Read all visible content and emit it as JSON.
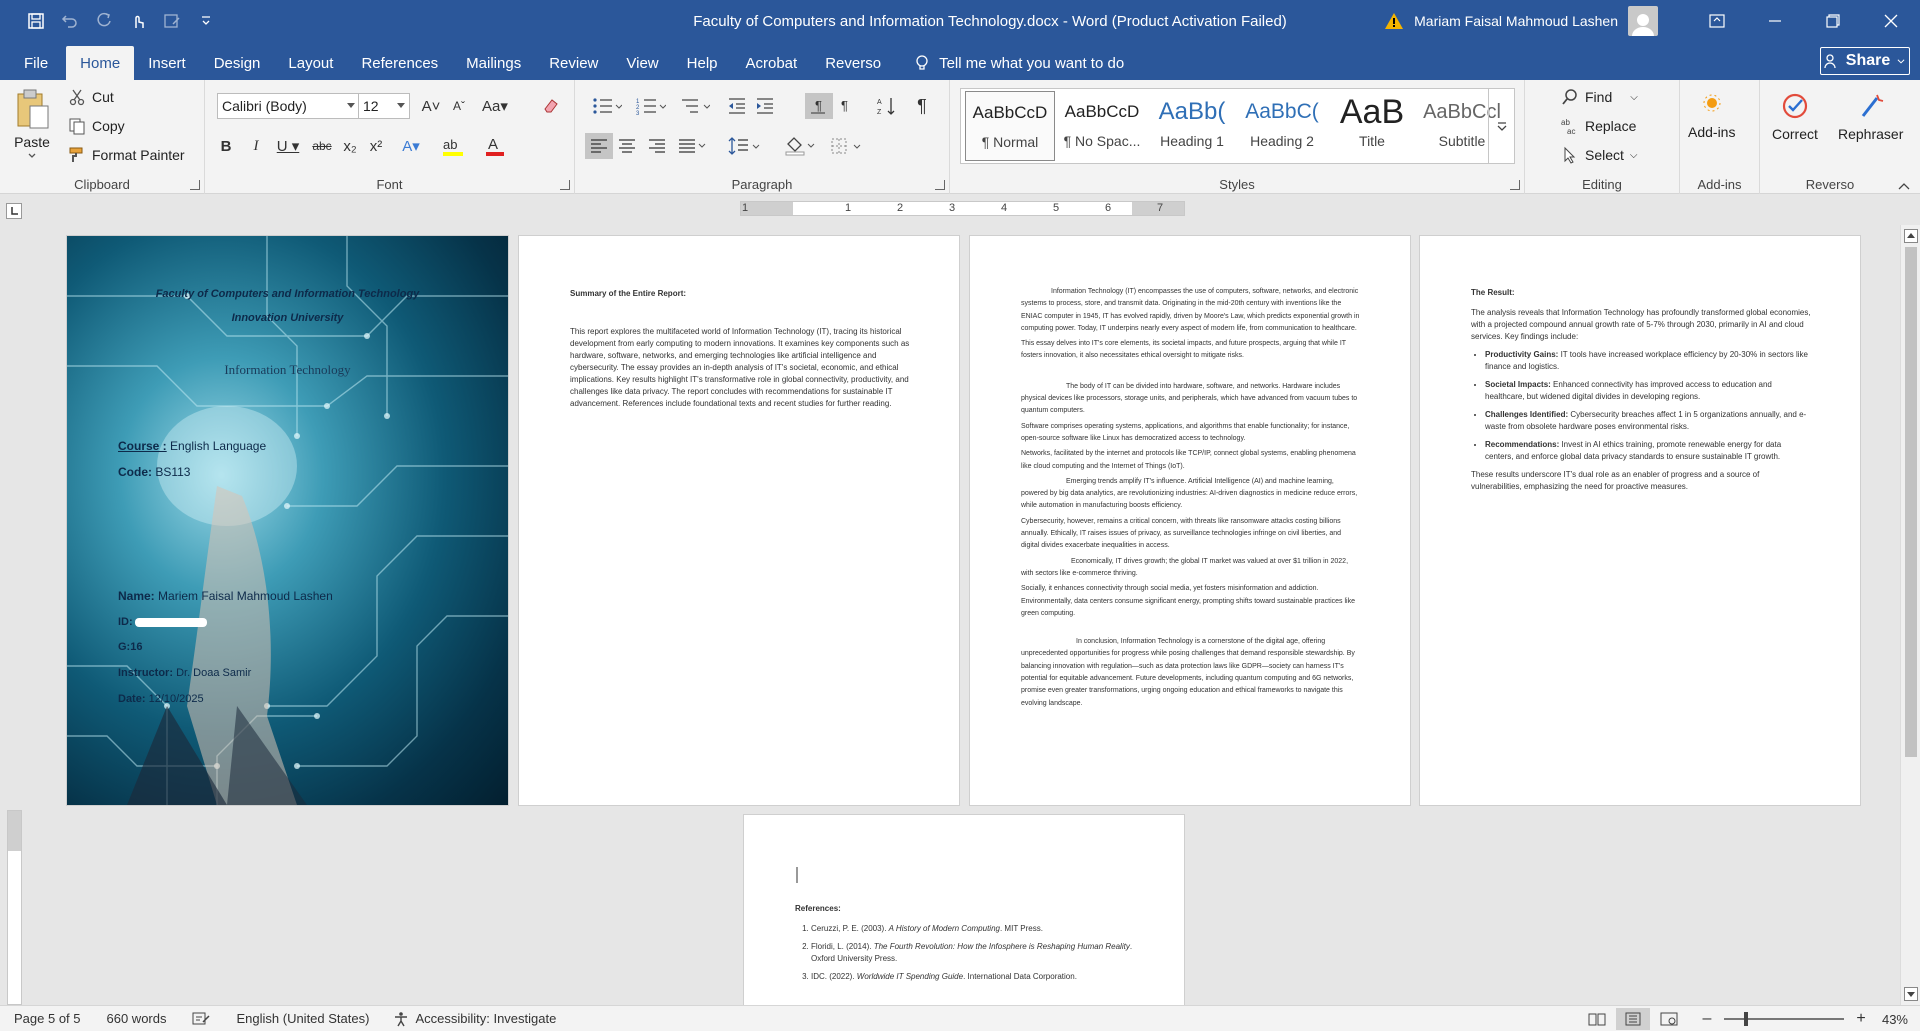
{
  "titlebar": {
    "title": "Faculty of Computers and Information Technology.docx  -  Word (Product Activation Failed)",
    "user": "Mariam Faisal Mahmoud Lashen"
  },
  "tabs": [
    "File",
    "Home",
    "Insert",
    "Design",
    "Layout",
    "References",
    "Mailings",
    "Review",
    "View",
    "Help",
    "Acrobat",
    "Reverso"
  ],
  "active_tab": "Home",
  "tell_me": "Tell me what you want to do",
  "share": "Share",
  "clipboard": {
    "paste": "Paste",
    "cut": "Cut",
    "copy": "Copy",
    "format_painter": "Format Painter",
    "label": "Clipboard"
  },
  "font": {
    "family": "Calibri (Body)",
    "size": "12",
    "label": "Font"
  },
  "paragraph": {
    "label": "Paragraph"
  },
  "styles": {
    "label": "Styles",
    "items": [
      {
        "sample": "AaBbCcD",
        "name": "¶ Normal"
      },
      {
        "sample": "AaBbCcD",
        "name": "¶ No Spac..."
      },
      {
        "sample": "AaBb(",
        "name": "Heading 1"
      },
      {
        "sample": "AaBbC(",
        "name": "Heading 2"
      },
      {
        "sample": "AaB",
        "name": "Title"
      },
      {
        "sample": "AaBbCcl",
        "name": "Subtitle"
      }
    ]
  },
  "editing": {
    "find": "Find",
    "replace": "Replace",
    "select": "Select",
    "label": "Editing"
  },
  "addins": {
    "button": "Add-ins",
    "label": "Add-ins"
  },
  "reverso": {
    "correct": "Correct",
    "rephraser": "Rephraser",
    "label": "Reverso"
  },
  "cover": {
    "faculty": "Faculty of Computers and Information Technology",
    "university": "Innovation University",
    "subject": "Information Technology",
    "course_label": "Course :",
    "course_value": "English Language",
    "code_label": "Code:",
    "code_value": "BS113",
    "name_label": "Name:",
    "name_value": "Mariem Faisal Mahmoud Lashen",
    "id_label": "ID:",
    "group": "G:16",
    "instructor_label": "Instructor:",
    "instructor_value": "Dr. Doaa Samir",
    "date_label": "Date:",
    "date_value": "12/10/2025"
  },
  "page2": {
    "heading": "Summary of the Entire Report:",
    "body": "This report explores the multifaceted world of Information Technology (IT), tracing its historical development from early computing to modern innovations. It examines key components such as hardware, software, networks, and emerging technologies like artificial intelligence and cybersecurity. The essay provides an in-depth analysis of IT's societal, economic, and ethical implications. Key results highlight IT's transformative role in global connectivity, productivity, and challenges like data privacy. The report concludes with recommendations for sustainable IT advancement. References include foundational texts and recent studies for further reading."
  },
  "page3": {
    "paragraphs": [
      "Information Technology (IT) encompasses the use of computers, software, networks, and electronic systems to process, store, and transmit data. Originating in the mid-20th century with inventions like the ENIAC computer in 1945, IT has evolved rapidly, driven by Moore's Law, which predicts exponential growth in computing power. Today, IT underpins nearly every aspect of modern life, from communication to healthcare.",
      "This essay delves into IT's core elements, its societal impacts, and future prospects, arguing that while IT fosters innovation, it also necessitates ethical oversight to mitigate risks.",
      "The body of IT can be divided into hardware, software, and networks. Hardware includes physical devices like processors, storage units, and peripherals, which have advanced from vacuum tubes to quantum computers.",
      "Software comprises operating systems, applications, and algorithms that enable functionality; for instance, open-source software like Linux has democratized access to technology.",
      "Networks, facilitated by the internet and protocols like TCP/IP, connect global systems, enabling phenomena like cloud computing and the Internet of Things (IoT).",
      "Emerging trends amplify IT's influence. Artificial Intelligence (AI) and machine learning, powered by big data analytics, are revolutionizing industries: AI-driven diagnostics in medicine reduce errors, while automation in manufacturing boosts efficiency.",
      "Cybersecurity, however, remains a critical concern, with threats like ransomware attacks costing billions annually. Ethically, IT raises issues of privacy, as surveillance technologies infringe on civil liberties, and digital divides exacerbate inequalities in access.",
      "Economically, IT drives growth; the global IT market was valued at over $1 trillion in 2022, with sectors like e-commerce thriving.",
      "Socially, it enhances connectivity through social media, yet fosters misinformation and addiction. Environmentally, data centers consume significant energy, prompting shifts toward sustainable practices like green computing.",
      "In conclusion, Information Technology is a cornerstone of the digital age, offering unprecedented opportunities for progress while posing challenges that demand responsible stewardship. By balancing innovation with regulation—such as data protection laws like GDPR—society can harness IT's potential for equitable advancement. Future developments, including quantum computing and 6G networks, promise even greater transformations, urging ongoing education and ethical frameworks to navigate this evolving landscape."
    ]
  },
  "page4": {
    "heading": "The Result:",
    "intro": "The analysis reveals that Information Technology has profoundly transformed global economies, with a projected compound annual growth rate of 5-7% through 2030, primarily in AI and cloud services. Key findings include:",
    "bullets": [
      {
        "label": "Productivity Gains:",
        "text": " IT tools have increased workplace efficiency by 20-30% in sectors like finance and logistics."
      },
      {
        "label": "Societal Impacts:",
        "text": " Enhanced connectivity has improved access to education and healthcare, but widened digital divides in developing regions."
      },
      {
        "label": "Challenges Identified:",
        "text": " Cybersecurity breaches affect 1 in 5 organizations annually, and e-waste from obsolete hardware poses environmental risks."
      },
      {
        "label": "Recommendations:",
        "text": " Invest in AI ethics training, promote renewable energy for data centers, and enforce global data privacy standards to ensure sustainable IT growth."
      }
    ],
    "outro": "These results underscore IT's dual role as an enabler of progress and a source of vulnerabilities, emphasizing the need for proactive measures."
  },
  "page5": {
    "heading": "References:",
    "refs": [
      {
        "author": "Ceruzzi, P. E. (2003). ",
        "title": "A History of Modern Computing",
        "rest": ". MIT Press."
      },
      {
        "author": "Floridi, L. (2014). ",
        "title": "The Fourth Revolution: How the Infosphere is Reshaping Human Reality",
        "rest": ". Oxford University Press."
      },
      {
        "author": "IDC. (2022). ",
        "title": "Worldwide IT Spending Guide",
        "rest": ". International Data Corporation."
      }
    ]
  },
  "ruler": {
    "ticks": [
      "1",
      "1",
      "2",
      "3",
      "4",
      "5",
      "6",
      "7"
    ]
  },
  "status": {
    "page": "Page 5 of 5",
    "words": "660 words",
    "language": "English (United States)",
    "accessibility": "Accessibility: Investigate",
    "zoom": "43%"
  }
}
